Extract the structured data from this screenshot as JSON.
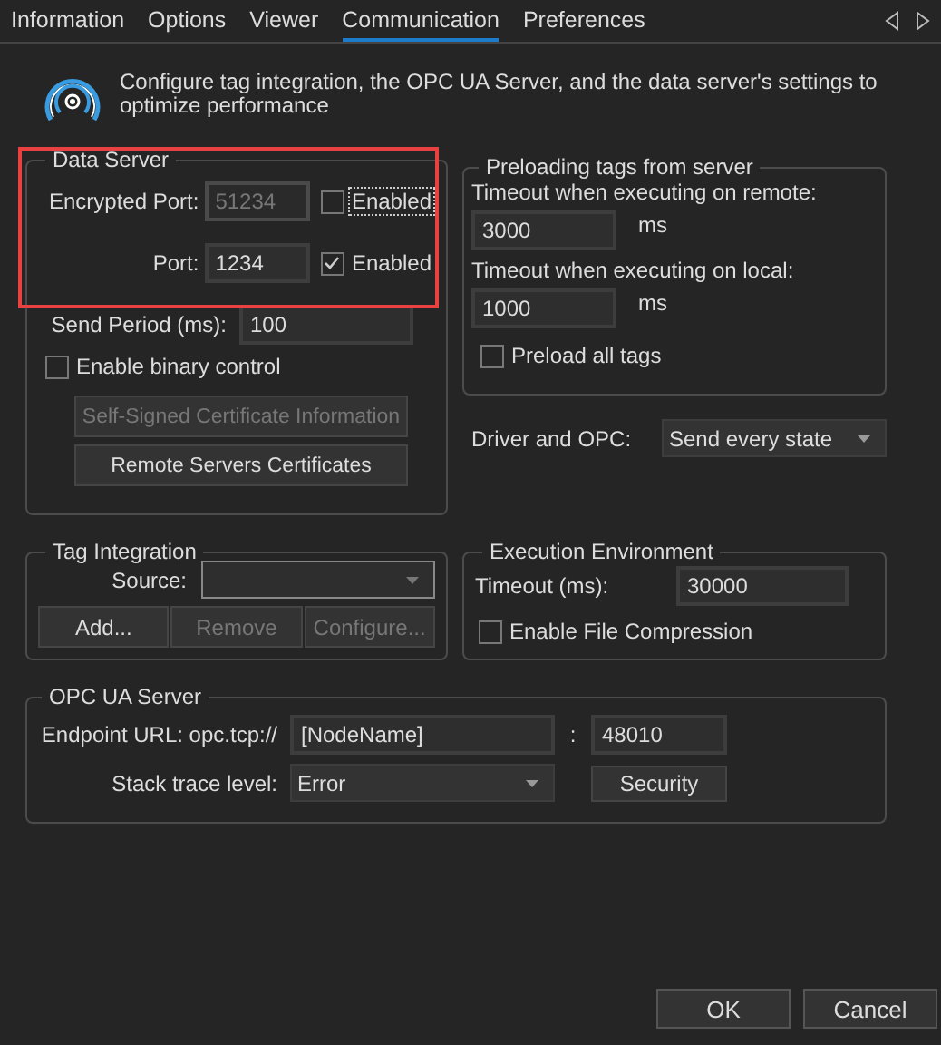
{
  "tabs": [
    {
      "label": "Information",
      "selected": false
    },
    {
      "label": "Options",
      "selected": false
    },
    {
      "label": "Viewer",
      "selected": false
    },
    {
      "label": "Communication",
      "selected": true
    },
    {
      "label": "Preferences",
      "selected": false
    }
  ],
  "header": {
    "text": "Configure tag integration, the OPC UA Server, and the data server's settings to optimize performance"
  },
  "data_server": {
    "title": "Data Server",
    "highlighted": true,
    "ports": [
      {
        "label": "Encrypted Port:",
        "value": "51234",
        "disabled": true,
        "enabled": {
          "label": "Enabled",
          "checked": false,
          "focused": true
        }
      },
      {
        "label": "Port:",
        "value": "1234",
        "disabled": false,
        "enabled": {
          "label": "Enabled",
          "checked": true,
          "focused": false
        }
      }
    ],
    "send_period": {
      "label": "Send Period (ms):",
      "value": "100"
    },
    "binary_control": {
      "label": "Enable binary control",
      "checked": false
    },
    "buttons": [
      {
        "label": "Self-Signed Certificate Information",
        "disabled": true
      },
      {
        "label": "Remote Servers Certificates",
        "disabled": false
      }
    ]
  },
  "preloading": {
    "title": "Preloading tags from server",
    "timeouts": [
      {
        "label": "Timeout when executing on remote:",
        "value": "3000",
        "unit": "ms"
      },
      {
        "label": "Timeout when executing on local:",
        "value": "1000",
        "unit": "ms"
      }
    ],
    "preload_all": {
      "label": "Preload all tags",
      "checked": false
    }
  },
  "driver_opc": {
    "label": "Driver and OPC:",
    "value": "Send every state"
  },
  "tag_integration": {
    "title": "Tag Integration",
    "source_label": "Source:",
    "buttons": [
      {
        "label": "Add...",
        "disabled": false
      },
      {
        "label": "Remove",
        "disabled": true
      },
      {
        "label": "Configure...",
        "disabled": true
      }
    ]
  },
  "execution_environment": {
    "title": "Execution Environment",
    "timeout_label": "Timeout (ms):",
    "timeout_value": "30000",
    "compression": {
      "label": "Enable File Compression",
      "checked": false
    }
  },
  "opc_ua_server": {
    "title": "OPC UA Server",
    "endpoint_label": "Endpoint URL: opc.tcp://",
    "node_value": "[NodeName]",
    "separator": ":",
    "port_value": "48010",
    "stack_label": "Stack trace level:",
    "stack_value": "Error",
    "security_button": "Security"
  },
  "buttons": [
    {
      "label": "OK"
    },
    {
      "label": "Cancel"
    }
  ]
}
